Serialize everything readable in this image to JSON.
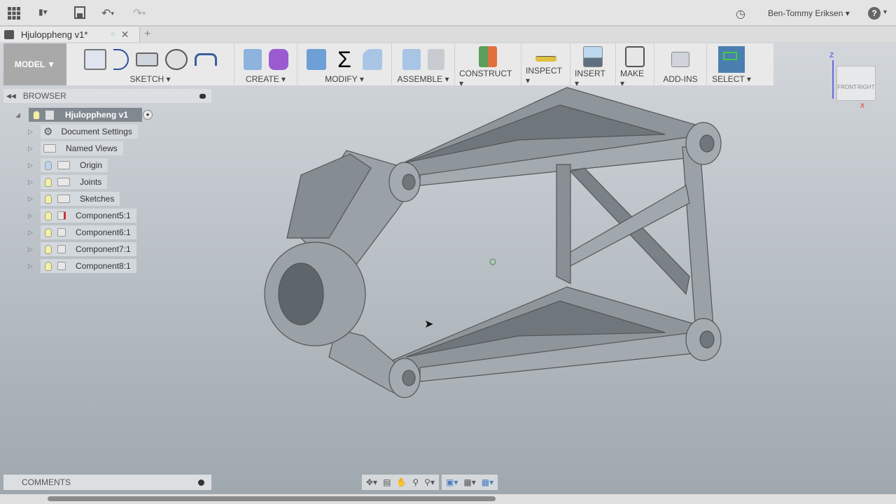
{
  "topbar": {
    "user": "Ben-Tommy Eriksen",
    "icons": [
      "grid-icon",
      "file-icon",
      "save-icon",
      "undo-icon",
      "redo-icon",
      "clock-icon",
      "help-icon"
    ]
  },
  "tab": {
    "title": "Hjuloppheng v1*"
  },
  "toolbar": {
    "mode": "MODEL ▼",
    "groups": [
      {
        "label": "SKETCH ▾"
      },
      {
        "label": "CREATE ▾"
      },
      {
        "label": "MODIFY ▾"
      },
      {
        "label": "ASSEMBLE ▾"
      },
      {
        "label": "CONSTRUCT ▾"
      },
      {
        "label": "INSPECT ▾"
      },
      {
        "label": "INSERT ▾"
      },
      {
        "label": "MAKE ▾"
      },
      {
        "label": "ADD-INS"
      },
      {
        "label": "SELECT ▾"
      }
    ]
  },
  "browser": {
    "title": "BROWSER",
    "root": "Hjuloppheng v1",
    "items": [
      {
        "label": "Document Settings"
      },
      {
        "label": "Named Views"
      },
      {
        "label": "Origin"
      },
      {
        "label": "Joints"
      },
      {
        "label": "Sketches"
      },
      {
        "label": "Component5:1"
      },
      {
        "label": "Component6:1"
      },
      {
        "label": "Component7:1"
      },
      {
        "label": "Component8:1"
      }
    ]
  },
  "viewcube": {
    "z": "Z",
    "x": "X",
    "front": "FRONT",
    "right": "RIGHT"
  },
  "comments": {
    "title": "COMMENTS"
  },
  "colors": {
    "select_active": "#4a7fb0",
    "model_bg": "#a9a9a9"
  }
}
